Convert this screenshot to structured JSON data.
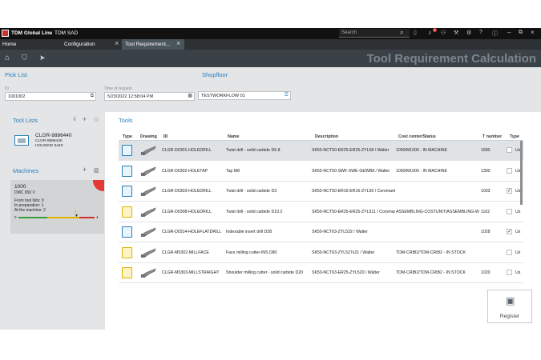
{
  "titlebar": {
    "app": "TDM Global Line",
    "user": "TDM SAD",
    "search_placeholder": "Search",
    "notification_count": "1"
  },
  "tabs": [
    {
      "label": "Home"
    },
    {
      "label": "Configuration"
    },
    {
      "label": "Tool Requirement..."
    }
  ],
  "page_title": "Tool Requirement Calculation",
  "picklist": {
    "heading": "Pick List",
    "id_label": "ID",
    "id_value": "1001002",
    "time_label": "Time of request",
    "time_value": "5/23/2022 12:58:04 PM",
    "shopfloor_heading": "Shopfloor",
    "shopfloor_value": "TESTWORKFLOW 01"
  },
  "toollists": {
    "heading": "Tool Lists",
    "item": {
      "id": "CLGR-9886440",
      "sub1": "CLGR-9886440",
      "sub2": "HOUSING 6440"
    }
  },
  "machines": {
    "heading": "Machines",
    "item": {
      "id": "1000",
      "name": "DMC 650 V",
      "from_tool_lists_label": "From tool lists:",
      "from_tool_lists": "9",
      "in_preparation_label": "In preparation:",
      "in_preparation": "1",
      "at_machine_label": "At the machine:",
      "at_machine": "2",
      "scale_min": "0",
      "scale_marker": "2",
      "scale_max": "4"
    }
  },
  "tools": {
    "heading": "Tools",
    "columns": [
      "Type",
      "Drawing",
      "ID",
      "Name",
      "Description",
      "Cost center/Status",
      "T number",
      "Type"
    ],
    "rows": [
      {
        "id": "CLGR-D0301-HOLEDRILL",
        "name": "Twist drill - solid carbide D6.8",
        "description": "SK50-NCT50-ER25-ER25-ZYL58 / Walter",
        "cost": "1000/M1000 - IN MACHINE",
        "tnum": "1680",
        "checked": false,
        "selected": true
      },
      {
        "id": "CLGR-D0302-HOLETAP",
        "name": "Tap M8",
        "description": "SK50-NCT50-SWF-SWE-GEWB8 / Walter",
        "cost": "1000/M1000 - IN MACHINE",
        "tnum": "1300",
        "checked": false,
        "selected": false
      },
      {
        "id": "CLGR-D0303-HOLEDRILL",
        "name": "Twist drill - solid carbide D3",
        "description": "SK50-NCT50-ER16-ER16-ZYL56 / Coromant",
        "cost": "",
        "tnum": "1003",
        "checked": true,
        "selected": false
      },
      {
        "id": "CLGR-D0308-HOLEDRILL",
        "name": "Twist drill - solid carbide D10.2",
        "description": "SK50-NCT50-ER25-ER25-ZYL511 / Coromant",
        "cost": "ASSEMBLING-COSTUNIT/ASSEMBLING-WOR",
        "tnum": "1102",
        "checked": false,
        "selected": false
      },
      {
        "id": "CLGR-D0314-HOLEFLATDRILL",
        "name": "Indexable insert drill D28",
        "description": "SK50-NCT63-ZYL532 / Walter",
        "cost": "",
        "tnum": "1028",
        "checked": true,
        "selected": false
      },
      {
        "id": "CLGR-M0302-MILLFACE",
        "name": "Face milling cutter-INS D80",
        "description": "SK50-NCT63-ZYL527x21 / Walter",
        "cost": "TDM-CRIB2/TDM-CRIB2 - IN STOCK",
        "tnum": "",
        "checked": false,
        "selected": false
      },
      {
        "id": "CLGR-M0303-MILLSTRAIGHT",
        "name": "Shoulder milling cutter - solid carbide D20",
        "description": "SK50-NCT63-ER25-ZYL520 / Walter",
        "cost": "TDM-CRIB2/TDM-CRIB2 - IN STOCK",
        "tnum": "1020",
        "checked": false,
        "selected": false
      }
    ],
    "type_abbrev": "Us"
  },
  "register_label": "Register",
  "colors": {
    "accent": "#2a7fb8",
    "red": "#e53935"
  }
}
